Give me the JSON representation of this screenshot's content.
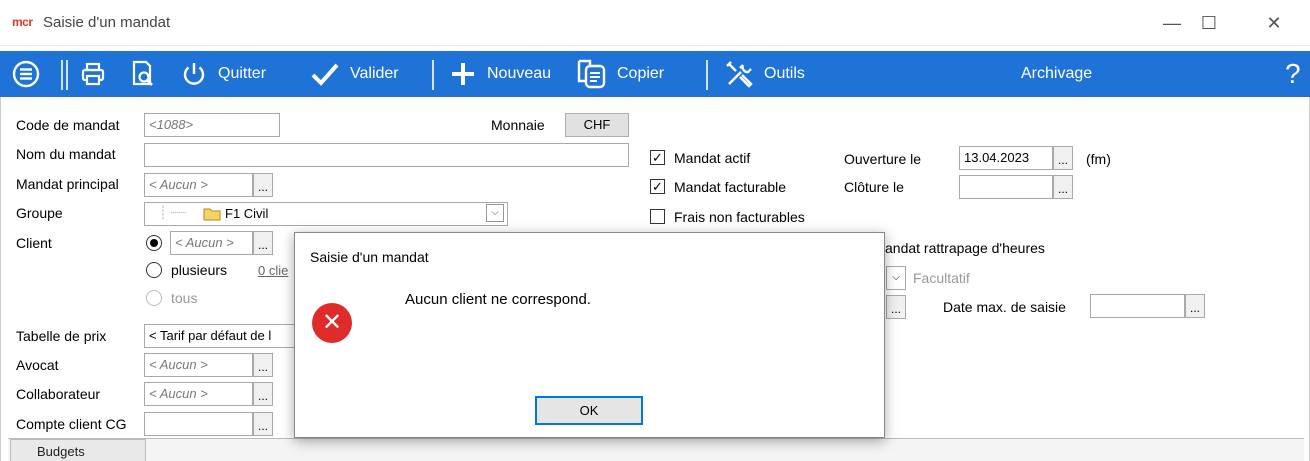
{
  "window": {
    "app_logo": "mcr",
    "title": "Saisie d'un mandat",
    "minimize": "—",
    "maximize": "☐",
    "close": "✕"
  },
  "toolbar": {
    "quit_label": "Quitter",
    "validate_label": "Valider",
    "new_label": "Nouveau",
    "copy_label": "Copier",
    "tools_label": "Outils",
    "archive_label": "Archivage",
    "help_label": "?"
  },
  "form": {
    "code_label": "Code de mandat",
    "code_value": "<1088>",
    "currency_label": "Monnaie",
    "currency_value": "CHF",
    "name_label": "Nom du mandat",
    "name_value": "",
    "main_mandate_label": "Mandat principal",
    "main_mandate_value": "< Aucun >",
    "group_label": "Groupe",
    "group_value": "F1 Civil",
    "client_label": "Client",
    "client_value": "< Aucun >",
    "client_multiple_label": "plusieurs",
    "client_multiple_count": "0 clie",
    "client_all_label": "tous",
    "price_table_label": "Tabelle de prix",
    "price_table_value": "< Tarif par défaut de l",
    "lawyer_label": "Avocat",
    "lawyer_value": "< Aucun >",
    "collaborator_label": "Collaborateur",
    "collaborator_value": "< Aucun >",
    "client_account_label": "Compte client CG",
    "client_account_value": "",
    "dots": "...",
    "active_label": "Mandat actif",
    "billable_label": "Mandat facturable",
    "non_billable_fees_label": "Frais non facturables",
    "opening_label": "Ouverture le",
    "opening_value": "13.04.2023",
    "opening_suffix": "(fm)",
    "closing_label": "Clôture le",
    "closing_value": "",
    "catchup_label": "andat rattrapage d'heures",
    "optional_label": "Facultatif",
    "max_date_label": "Date max. de saisie",
    "max_date_value": "",
    "checked_mark": "✓"
  },
  "dialog": {
    "title": "Saisie d'un mandat",
    "message": "Aucun client ne correspond.",
    "ok_label": "OK",
    "icon_glyph": "✕"
  },
  "bottom": {
    "tab_label": "Budgets"
  },
  "colors": {
    "toolbar_bg": "#1f73d6",
    "error_red": "#e02b2b"
  }
}
